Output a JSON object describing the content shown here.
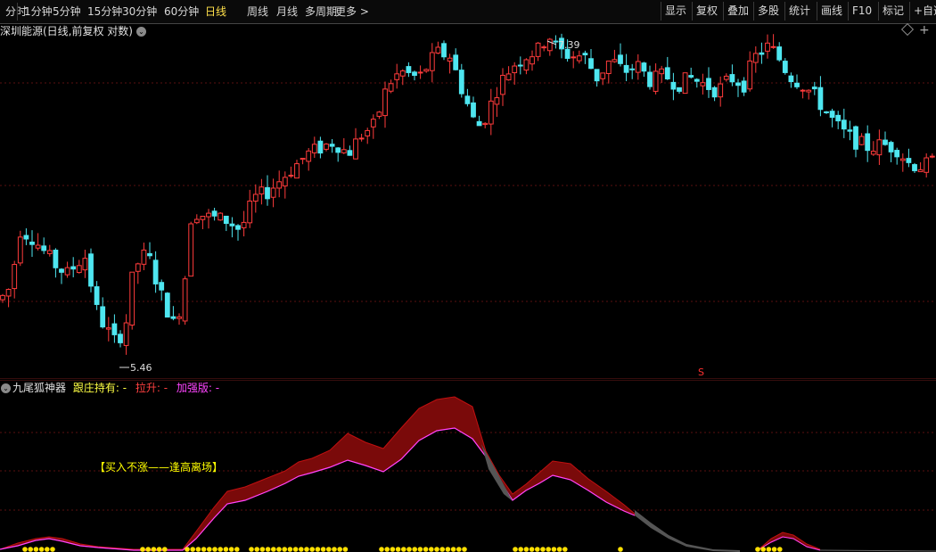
{
  "toolbar": {
    "periods": [
      "分时",
      "1分钟",
      "5分钟",
      "15分钟",
      "30分钟",
      "60分钟",
      "日线",
      "周线",
      "月线",
      "多周期",
      "更多 >"
    ],
    "selected": "日线",
    "right": [
      "显示",
      "复权",
      "叠加",
      "多股",
      "统计",
      "画线",
      "F10",
      "标记",
      "+自选"
    ]
  },
  "main": {
    "title": "深圳能源(日线,前复权 对数)",
    "high_label": "7.39",
    "low_label": "5.46",
    "marker": "S"
  },
  "indicator": {
    "name": "九尾狐神器",
    "line1": "跟庄持有: -",
    "line2": "拉升: -",
    "line3": "加强版: -",
    "note": "【买入不涨——逢高离场】"
  },
  "colors": {
    "up": "#ff3b3b",
    "down": "#4ee6f0",
    "accent": "#ffe04a",
    "grid": "#7a1c1c"
  }
}
